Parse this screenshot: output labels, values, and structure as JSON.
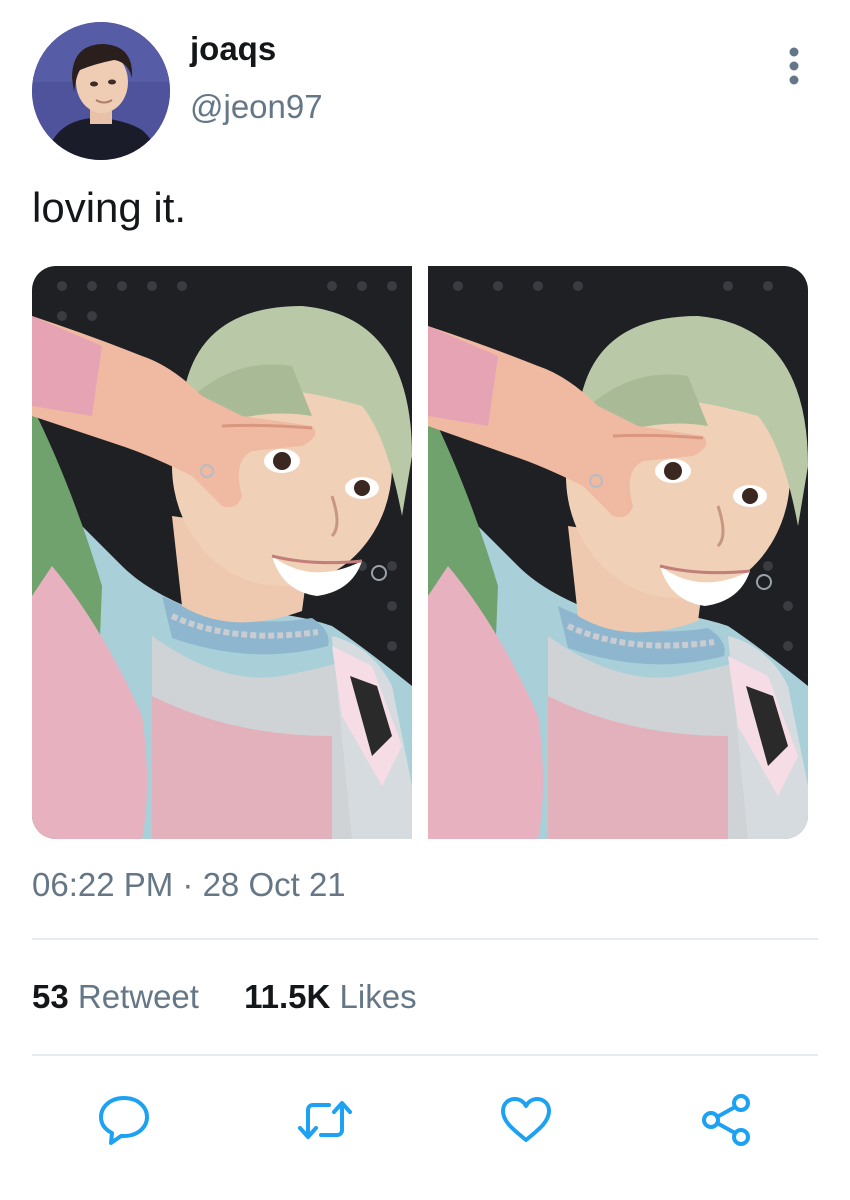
{
  "tweet": {
    "display_name": "joaqs",
    "handle": "@jeon97",
    "text": "loving it.",
    "timestamp": "06:22 PM · 28 Oct 21",
    "media_count": 2
  },
  "stats": {
    "retweets_count": "53",
    "retweets_label": "Retweet",
    "likes_count": "11.5K",
    "likes_label": "Likes"
  },
  "icons": {
    "more": "more-vertical-icon",
    "reply": "reply-icon",
    "retweet": "retweet-icon",
    "like": "heart-icon",
    "share": "share-icon"
  },
  "colors": {
    "text_primary": "#14171a",
    "text_secondary": "#657786",
    "icon": "#1da1f2",
    "divider": "#e6ecf0"
  }
}
